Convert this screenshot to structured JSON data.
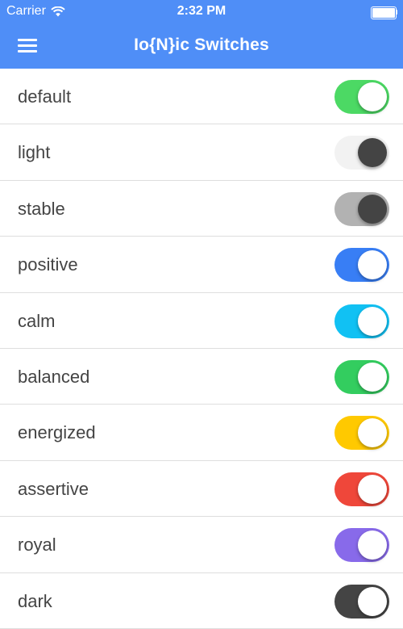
{
  "status_bar": {
    "carrier": "Carrier",
    "time": "2:32 PM"
  },
  "nav": {
    "title": "Io{N}ic Switches",
    "menu_icon": "hamburger-menu-icon"
  },
  "switches": [
    {
      "label": "default",
      "state": "on",
      "track": "#4cd964",
      "knob": "#ffffff"
    },
    {
      "label": "light",
      "state": "on",
      "track": "#f2f2f2",
      "knob": "#444444"
    },
    {
      "label": "stable",
      "state": "on",
      "track": "#b2b2b2",
      "knob": "#444444"
    },
    {
      "label": "positive",
      "state": "on",
      "track": "#387ef5",
      "knob": "#ffffff"
    },
    {
      "label": "calm",
      "state": "on",
      "track": "#11c1f3",
      "knob": "#ffffff"
    },
    {
      "label": "balanced",
      "state": "on",
      "track": "#33cd5f",
      "knob": "#ffffff"
    },
    {
      "label": "energized",
      "state": "on",
      "track": "#ffc900",
      "knob": "#ffffff"
    },
    {
      "label": "assertive",
      "state": "on",
      "track": "#ef473a",
      "knob": "#ffffff"
    },
    {
      "label": "royal",
      "state": "on",
      "track": "#886aea",
      "knob": "#ffffff"
    },
    {
      "label": "dark",
      "state": "on",
      "track": "#444444",
      "knob": "#ffffff"
    }
  ]
}
